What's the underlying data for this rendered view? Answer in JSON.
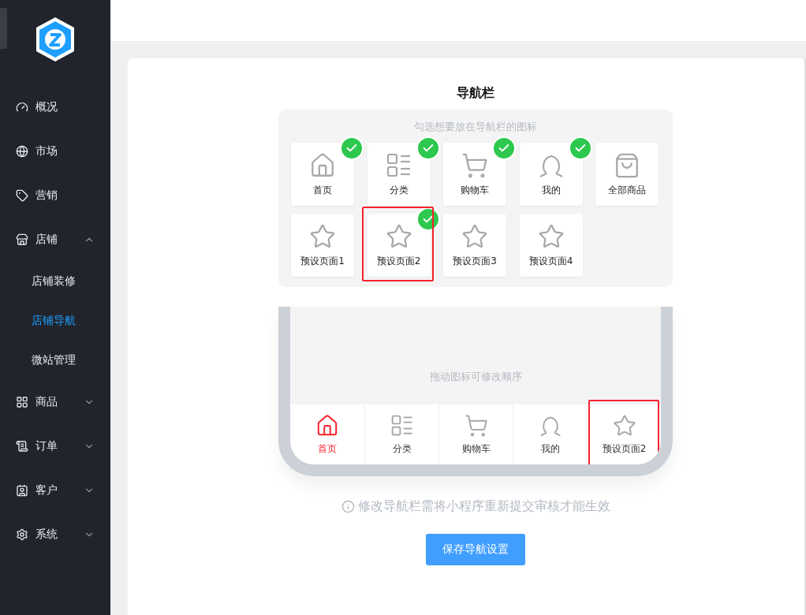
{
  "sidebar": {
    "items": [
      {
        "label": "概况"
      },
      {
        "label": "市场"
      },
      {
        "label": "营销"
      },
      {
        "label": "店铺",
        "expanded": true,
        "children": [
          {
            "label": "店铺装修",
            "selected": false
          },
          {
            "label": "店铺导航",
            "selected": true
          },
          {
            "label": "微站管理",
            "selected": false
          }
        ]
      },
      {
        "label": "商品",
        "expanded": false
      },
      {
        "label": "订单",
        "expanded": false
      },
      {
        "label": "客户",
        "expanded": false
      },
      {
        "label": "系统",
        "expanded": false
      }
    ]
  },
  "title": "导航栏",
  "picker": {
    "hint": "勾选想要放在导航栏的图标",
    "options": [
      {
        "label": "首页",
        "checked": true,
        "highlighted": false
      },
      {
        "label": "分类",
        "checked": true,
        "highlighted": false
      },
      {
        "label": "购物车",
        "checked": true,
        "highlighted": false
      },
      {
        "label": "我的",
        "checked": true,
        "highlighted": false
      },
      {
        "label": "全部商品",
        "checked": false,
        "highlighted": false
      },
      {
        "label": "预设页面1",
        "checked": false,
        "highlighted": false
      },
      {
        "label": "预设页面2",
        "checked": true,
        "highlighted": true
      },
      {
        "label": "预设页面3",
        "checked": false,
        "highlighted": false
      },
      {
        "label": "预设页面4",
        "checked": false,
        "highlighted": false
      }
    ]
  },
  "preview": {
    "hint": "拖动图标可修改顺序",
    "tabs": [
      {
        "label": "首页",
        "selected": true,
        "highlighted": false
      },
      {
        "label": "分类",
        "selected": false,
        "highlighted": false
      },
      {
        "label": "购物车",
        "selected": false,
        "highlighted": false
      },
      {
        "label": "我的",
        "selected": false,
        "highlighted": false
      },
      {
        "label": "预设页面2",
        "selected": false,
        "highlighted": true
      }
    ]
  },
  "notice": "修改导航栏需将小程序重新提交审核才能生效",
  "save_button": "保存导航设置"
}
